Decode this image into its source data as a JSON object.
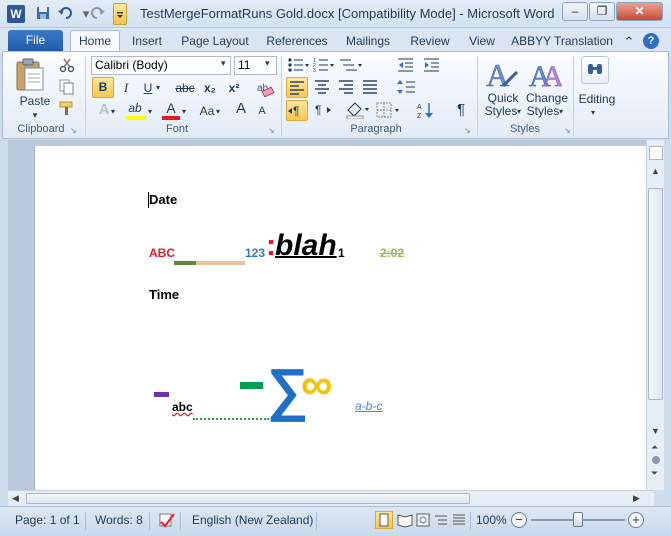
{
  "window": {
    "title": "TestMergeFormatRuns Gold.docx [Compatibility Mode]  -  Microsoft Word",
    "word_logo": "W",
    "minimize_glyph": "–",
    "restore_glyph": "❐",
    "close_glyph": "✕"
  },
  "tabs": {
    "file": "File",
    "items": [
      "Home",
      "Insert",
      "Page Layout",
      "References",
      "Mailings",
      "Review",
      "View",
      "ABBYY Translation"
    ]
  },
  "ribbon": {
    "clipboard": {
      "paste": "Paste",
      "label": "Clipboard"
    },
    "font": {
      "name": "Calibri (Body)",
      "size": "11",
      "label": "Font",
      "bold": "B",
      "italic": "I",
      "underline": "U",
      "strike": "abc",
      "subscript": "x₂",
      "superscript": "x²",
      "text_effects": "A",
      "highlight": "ab",
      "font_color": "A",
      "change_case": "Aa",
      "grow": "A",
      "shrink": "A"
    },
    "paragraph": {
      "label": "Paragraph",
      "pilcrow": "¶"
    },
    "styles": {
      "quick_styles": "Quick",
      "quick_styles2": "Styles",
      "change_styles": "Change",
      "change_styles2": "Styles",
      "label": "Styles"
    },
    "editing": {
      "label": "Editing"
    }
  },
  "document": {
    "date": "Date",
    "abc_red": "ABC",
    "num": "123",
    "colon": ":",
    "blah": "blah",
    "one": "1",
    "time_val": "2:02",
    "time": "Time",
    "abc_small": "abc",
    "abc_dash": "a-b-c",
    "sigma": "∑",
    "infinity": "∞"
  },
  "status": {
    "page": "Page: 1 of 1",
    "words": "Words: 8",
    "language": "English (New Zealand)",
    "zoom": "100%"
  },
  "colors": {
    "red": "#e01b24",
    "teal": "#2d7fb0",
    "green_line": "#5a8a3a",
    "tan_line": "#e8c39c",
    "olive": "#8fbf52",
    "purple": "#7030a0",
    "green": "#00a050",
    "blue": "#1f6fc5",
    "gold": "#f5c400"
  }
}
